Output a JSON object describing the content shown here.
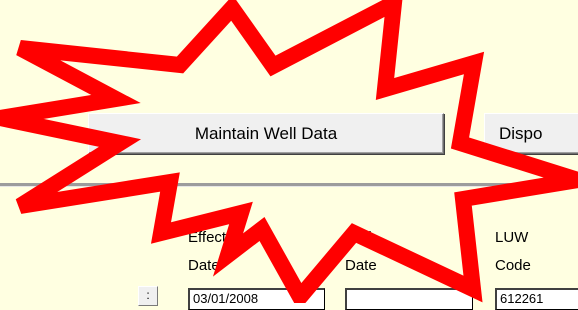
{
  "top_panel": {
    "buttons": {
      "maintain_label": "Maintain Well Data",
      "dispo_label": "Dispo"
    }
  },
  "grid": {
    "columns": [
      {
        "label": "Effective\nDate",
        "value": "03/01/2008"
      },
      {
        "label": "End\nDate",
        "value": ""
      },
      {
        "label": "LUW\nCode",
        "value": "612261"
      }
    ],
    "row_selector": ":"
  },
  "overlay": {
    "shape": "starburst",
    "stroke_color": "#ff0000"
  }
}
